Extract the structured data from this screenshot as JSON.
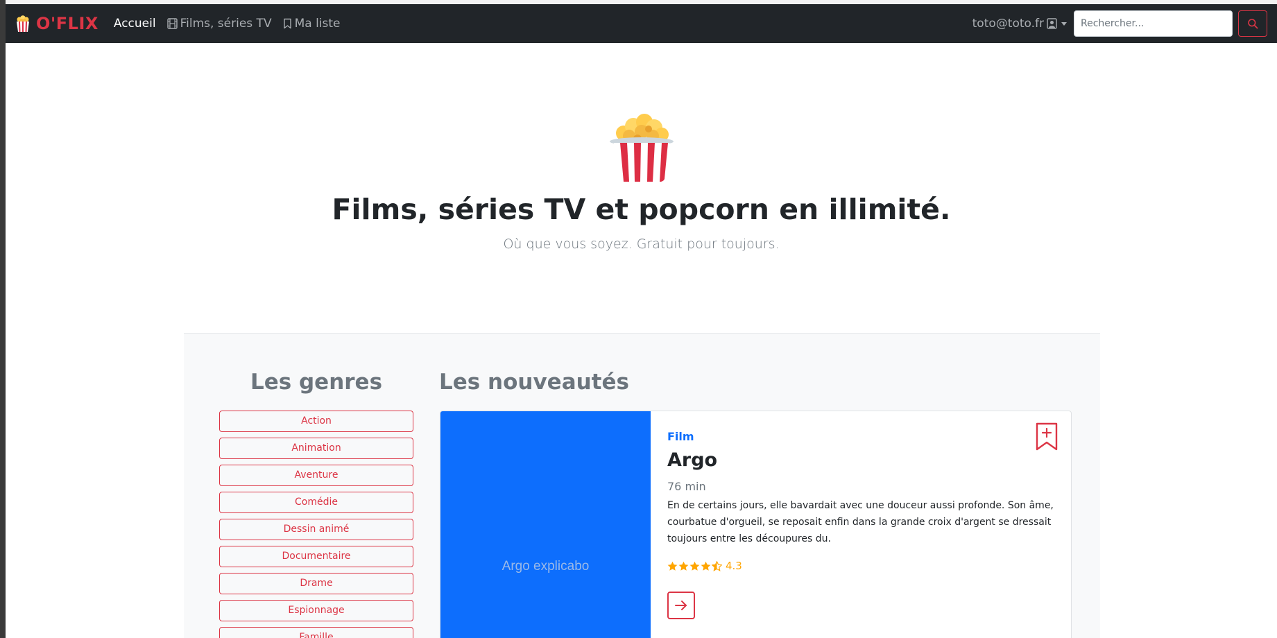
{
  "navbar": {
    "brand": "O'FLIX",
    "links": [
      {
        "label": "Accueil",
        "active": true
      },
      {
        "label": "Films, séries TV",
        "icon": "film-icon"
      },
      {
        "label": "Ma liste",
        "icon": "bookmark-icon"
      }
    ],
    "user": "toto@toto.fr",
    "search_placeholder": "Rechercher..."
  },
  "hero": {
    "title": "Films, séries TV et popcorn en illimité.",
    "subtitle": "Où que vous soyez. Gratuit pour toujours."
  },
  "genres": {
    "title": "Les genres",
    "items": [
      "Action",
      "Animation",
      "Aventure",
      "Comédie",
      "Dessin animé",
      "Documentaire",
      "Drame",
      "Espionnage",
      "Famille"
    ]
  },
  "news": {
    "title": "Les nouveautés",
    "card": {
      "image_alt": "Argo explicabo",
      "type": "Film",
      "title": "Argo",
      "duration": "76 min",
      "description": "En de certains jours, elle bavardait avec une douceur aussi profonde. Son âme, courbatue d'orgueil, se reposait enfin dans la grande croix d'argent se dressait toujours entre les découpures du.",
      "rating": "4.3",
      "rating_value": 4.3
    }
  },
  "colors": {
    "brand": "#dc3545",
    "navbar": "#212529",
    "primary": "#0d6efd",
    "star": "#ffa500"
  }
}
